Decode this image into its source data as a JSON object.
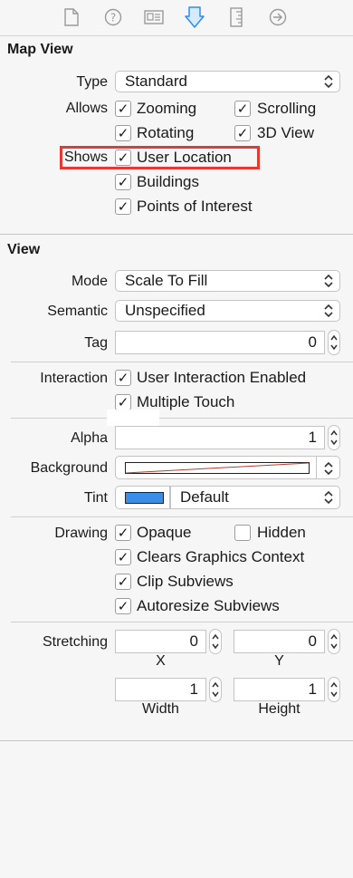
{
  "toolbar": {
    "icons": [
      "file-icon",
      "help-icon",
      "identity-icon",
      "attributes-icon",
      "size-icon",
      "connections-icon"
    ],
    "accent": "#2f8cf0",
    "inactive": "#9a9a9a"
  },
  "map_view": {
    "title": "Map View",
    "type_label": "Type",
    "type_value": "Standard",
    "allows_label": "Allows",
    "allows": {
      "zooming": {
        "label": "Zooming",
        "checked": true
      },
      "scrolling": {
        "label": "Scrolling",
        "checked": true
      },
      "rotating": {
        "label": "Rotating",
        "checked": true
      },
      "view3d": {
        "label": "3D View",
        "checked": true
      }
    },
    "shows_label": "Shows",
    "shows": {
      "user_location": {
        "label": "User Location",
        "checked": true
      },
      "buildings": {
        "label": "Buildings",
        "checked": true
      },
      "poi": {
        "label": "Points of Interest",
        "checked": true
      }
    },
    "highlight_color": "#e53935"
  },
  "view": {
    "title": "View",
    "mode_label": "Mode",
    "mode_value": "Scale To Fill",
    "semantic_label": "Semantic",
    "semantic_value": "Unspecified",
    "tag_label": "Tag",
    "tag_value": "0",
    "interaction_label": "Interaction",
    "interaction": {
      "user_interaction": {
        "label": "User Interaction Enabled",
        "checked": true
      },
      "multiple_touch": {
        "label": "Multiple Touch",
        "checked": true
      }
    },
    "alpha_label": "Alpha",
    "alpha_value": "1",
    "background_label": "Background",
    "tint_label": "Tint",
    "tint_value": "Default",
    "tint_color": "#3a8ee6",
    "drawing_label": "Drawing",
    "drawing": {
      "opaque": {
        "label": "Opaque",
        "checked": true
      },
      "hidden": {
        "label": "Hidden",
        "checked": false
      },
      "clears": {
        "label": "Clears Graphics Context",
        "checked": true
      },
      "clip": {
        "label": "Clip Subviews",
        "checked": true
      },
      "autoresize": {
        "label": "Autoresize Subviews",
        "checked": true
      }
    },
    "stretching_label": "Stretching",
    "stretch_x": "0",
    "stretch_y": "0",
    "stretch_width": "1",
    "stretch_height": "1",
    "x_caption": "X",
    "y_caption": "Y",
    "width_caption": "Width",
    "height_caption": "Height"
  }
}
